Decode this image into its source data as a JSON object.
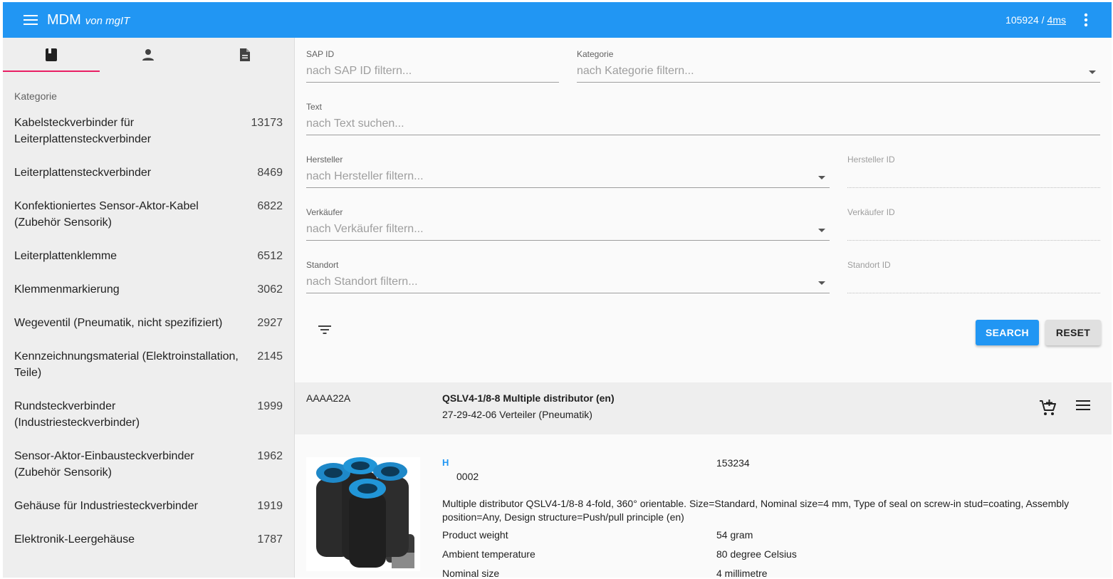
{
  "appbar": {
    "title": "MDM",
    "subtitle": "von mgIT",
    "count": "105924 /",
    "timing": "4ms"
  },
  "sidebar": {
    "tabs": [
      {
        "icon": "book-icon"
      },
      {
        "icon": "person-icon"
      },
      {
        "icon": "document-icon"
      }
    ],
    "category_heading": "Kategorie",
    "categories": [
      {
        "name": "Kabelsteckverbinder für Leiterplattensteckverbinder",
        "count": "13173"
      },
      {
        "name": "Leiterplattensteckverbinder",
        "count": "8469"
      },
      {
        "name": "Konfektioniertes Sensor-Aktor-Kabel (Zubehör Sensorik)",
        "count": "6822"
      },
      {
        "name": "Leiterplattenklemme",
        "count": "6512"
      },
      {
        "name": "Klemmenmarkierung",
        "count": "3062"
      },
      {
        "name": "Wegeventil (Pneumatik, nicht spezifiziert)",
        "count": "2927"
      },
      {
        "name": "Kennzeichnungsmaterial (Elektroinstallation, Teile)",
        "count": "2145"
      },
      {
        "name": "Rundsteckverbinder (Industriesteckverbinder)",
        "count": "1999"
      },
      {
        "name": "Sensor-Aktor-Einbausteckverbinder (Zubehör Sensorik)",
        "count": "1962"
      },
      {
        "name": "Gehäuse für Industriesteckverbinder",
        "count": "1919"
      },
      {
        "name": "Elektronik-Leergehäuse",
        "count": "1787"
      }
    ]
  },
  "filters": {
    "sap_id": {
      "label": "SAP ID",
      "placeholder": "nach SAP ID filtern..."
    },
    "kategorie": {
      "label": "Kategorie",
      "placeholder": "nach Kategorie filtern..."
    },
    "text": {
      "label": "Text",
      "placeholder": "nach Text suchen..."
    },
    "hersteller": {
      "label": "Hersteller",
      "placeholder": "nach Hersteller filtern..."
    },
    "hersteller_id": {
      "label": "Hersteller ID",
      "placeholder": ""
    },
    "verkaeufer": {
      "label": "Verkäufer",
      "placeholder": "nach Verkäufer filtern..."
    },
    "verkaeufer_id": {
      "label": "Verkäufer ID",
      "placeholder": ""
    },
    "standort": {
      "label": "Standort",
      "placeholder": "nach Standort filtern..."
    },
    "standort_id": {
      "label": "Standort ID",
      "placeholder": ""
    },
    "search_label": "SEARCH",
    "reset_label": "RESET"
  },
  "result": {
    "sap_id": "AAAA22A",
    "title": "QSLV4-1/8-8 Multiple distributor (en)",
    "category": "27-29-42-06 Verteiler (Pneumatik)",
    "h_label": "H",
    "code": "0002",
    "number": "153234",
    "description": "Multiple distributor QSLV4-1/8-8 4-fold, 360° orientable. Size=Standard, Nominal size=4 mm, Type of seal on screw-in stud=coating, Assembly position=Any, Design structure=Push/pull principle (en)",
    "attributes": [
      {
        "name": "Product weight",
        "value": "54 gram"
      },
      {
        "name": "Ambient temperature",
        "value": "80 degree Celsius"
      },
      {
        "name": "Nominal size",
        "value": "4 millimetre"
      }
    ]
  },
  "colors": {
    "primary": "#2196f3",
    "tab_indicator": "#e91e63"
  }
}
